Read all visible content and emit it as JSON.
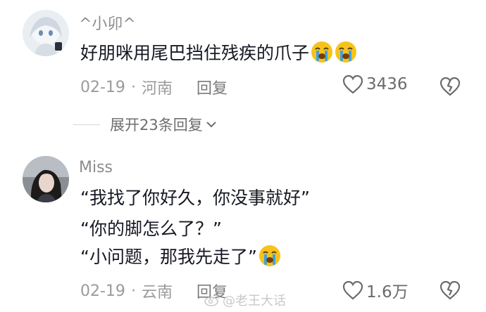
{
  "comments": [
    {
      "username": "^小卯^",
      "lines": [
        "好朋咪用尾巴挡住残疾的爪子"
      ],
      "emoji": "loudly-crying-emoji",
      "date": "02-19",
      "location": "河南",
      "reply_label": "回复",
      "likes": "3436",
      "expand_label": "展开23条回复"
    },
    {
      "username": "Miss",
      "lines": [
        "“我找了你好久，你没事就好”",
        "“你的脚怎么了？”",
        "“小问题，那我先走了”"
      ],
      "emoji": "loudly-crying-emoji",
      "date": "02-19",
      "location": "云南",
      "reply_label": "回复",
      "likes": "1.6万"
    }
  ],
  "meta_separator": "·",
  "watermark": "@老王大话",
  "colors": {
    "text_primary": "#161823",
    "text_secondary": "#9a9a9a",
    "emoji_face": "#f7c21b",
    "emoji_tears": "#3aa3e8"
  }
}
